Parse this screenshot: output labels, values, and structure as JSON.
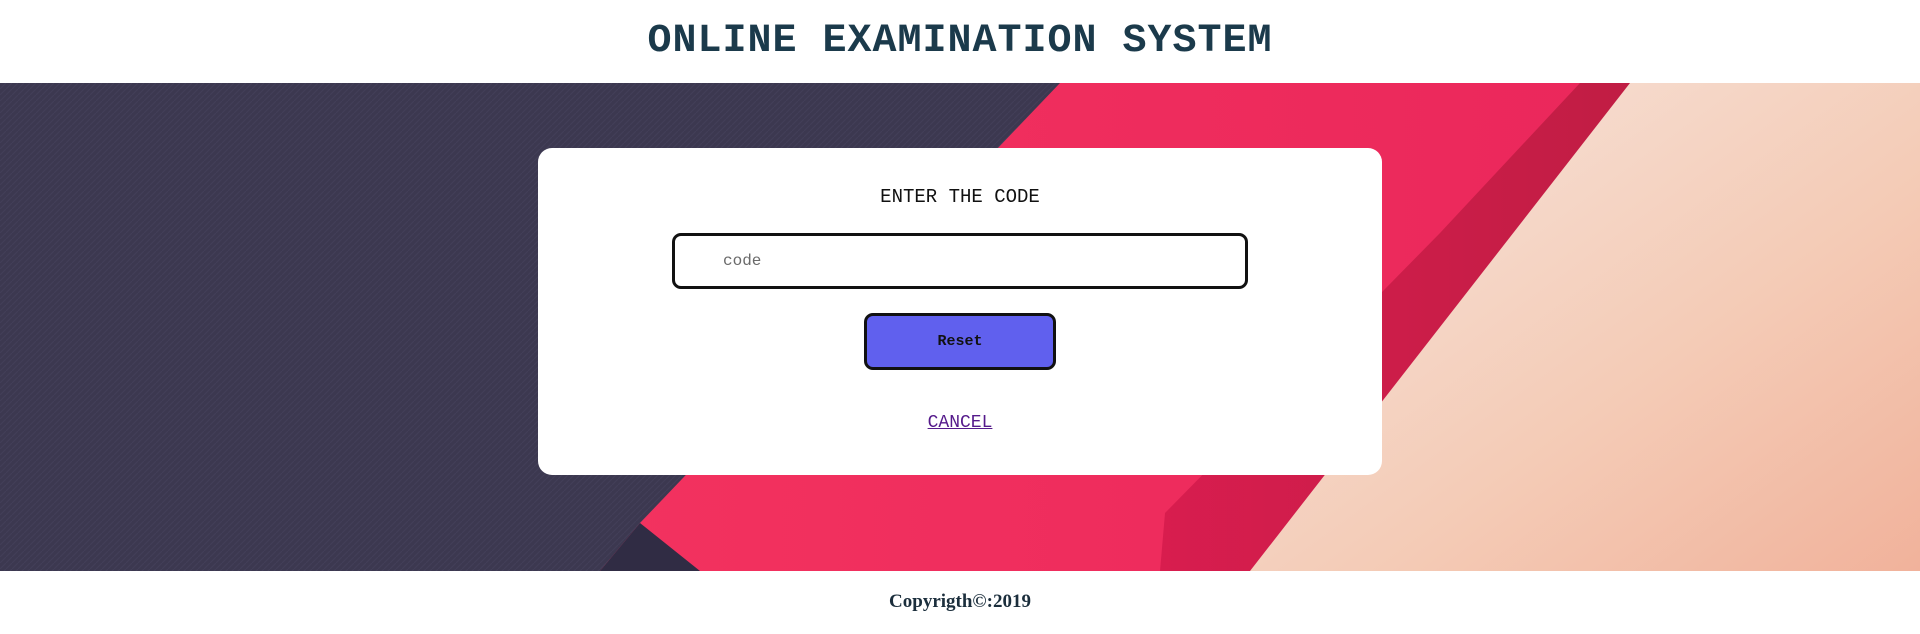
{
  "header": {
    "title": "ONLINE EXAMINATION SYSTEM"
  },
  "form": {
    "heading": "ENTER THE CODE",
    "code_placeholder": "code",
    "code_value": "",
    "reset_label": "Reset",
    "cancel_label": "CANCEL"
  },
  "footer": {
    "copyright": "Copyrigth©:2019"
  },
  "colors": {
    "title": "#1b3a4b",
    "hero_dark": "#3c3850",
    "hero_pink": "#f0305e",
    "hero_peach": "#f5cdb8",
    "button": "#6060ee",
    "link": "#551a8b"
  }
}
